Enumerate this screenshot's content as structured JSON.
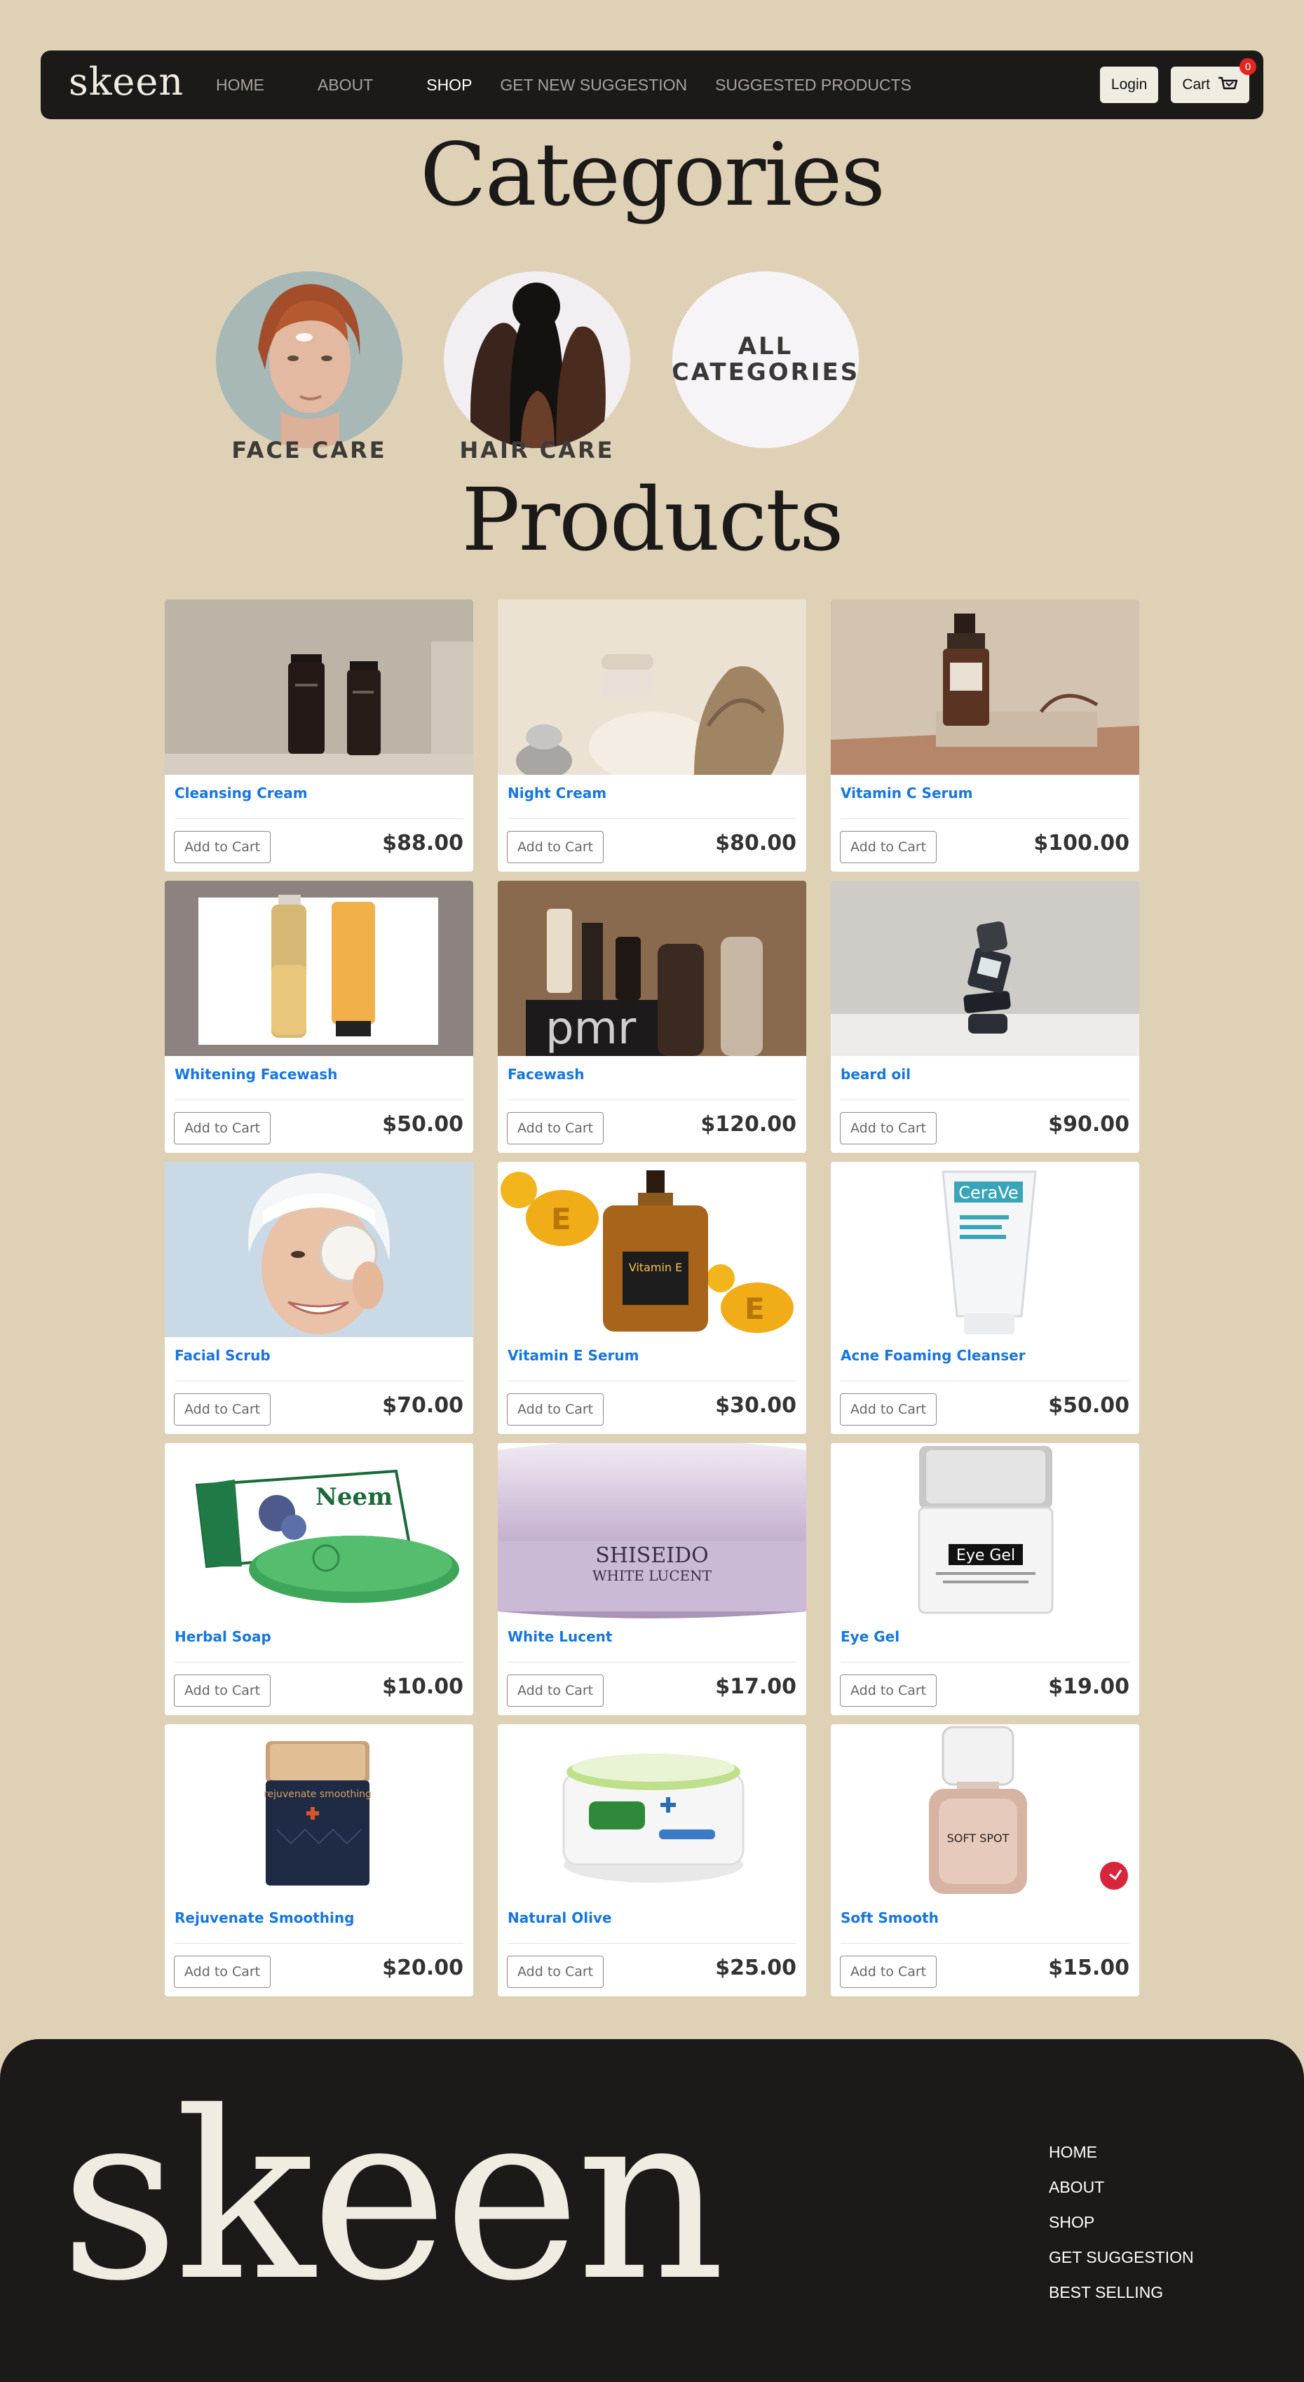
{
  "nav": {
    "brand": "skeen",
    "links": [
      "HOME",
      "ABOUT",
      "SHOP",
      "GET NEW SUGGESTION",
      "SUGGESTED PRODUCTS"
    ],
    "active": "SHOP",
    "login_label": "Login",
    "cart_label": "Cart",
    "cart_count": "0"
  },
  "headings": {
    "categories": "Categories",
    "products": "Products"
  },
  "categories": [
    {
      "label": "FACE CARE"
    },
    {
      "label": "HAIR CARE"
    },
    {
      "label_line1": "ALL",
      "label_line2": "CATEGORIES"
    }
  ],
  "products": [
    {
      "name": "Cleansing Cream",
      "price": "$88.00",
      "button": "Add to Cart",
      "icon": "amber-jars-image"
    },
    {
      "name": "Night Cream",
      "price": "$80.00",
      "button": "Add to Cart",
      "icon": "cream-jar-stones-image"
    },
    {
      "name": "Vitamin C Serum",
      "price": "$100.00",
      "button": "Add to Cart",
      "icon": "serum-bottle-image"
    },
    {
      "name": "Whitening Facewash",
      "price": "$50.00",
      "button": "Add to Cart",
      "icon": "facewash-bottles-image"
    },
    {
      "name": "Facewash",
      "price": "$120.00",
      "button": "Add to Cart",
      "icon": "cosmetics-set-image"
    },
    {
      "name": "beard oil",
      "price": "$90.00",
      "button": "Add to Cart",
      "icon": "stacked-jars-image"
    },
    {
      "name": "Facial Scrub",
      "price": "$70.00",
      "button": "Add to Cart",
      "icon": "woman-towel-image"
    },
    {
      "name": "Vitamin E Serum",
      "price": "$30.00",
      "button": "Add to Cart",
      "icon": "vitamin-e-bottle-image"
    },
    {
      "name": "Acne Foaming Cleanser",
      "price": "$50.00",
      "button": "Add to Cart",
      "icon": "cleanser-tube-image"
    },
    {
      "name": "Herbal Soap",
      "price": "$10.00",
      "button": "Add to Cart",
      "icon": "neem-soap-image"
    },
    {
      "name": "White Lucent",
      "price": "$17.00",
      "button": "Add to Cart",
      "icon": "shiseido-jar-image"
    },
    {
      "name": "Eye Gel",
      "price": "$19.00",
      "button": "Add to Cart",
      "icon": "eye-gel-jar-image"
    },
    {
      "name": "Rejuvenate Smoothing",
      "price": "$20.00",
      "button": "Add to Cart",
      "icon": "navy-jar-image"
    },
    {
      "name": "Natural Olive",
      "price": "$25.00",
      "button": "Add to Cart",
      "icon": "olive-cream-jar-image"
    },
    {
      "name": "Soft Smooth",
      "price": "$15.00",
      "button": "Add to Cart",
      "icon": "perfume-bottle-image"
    }
  ],
  "image_text": {
    "shiseido_brand": "SHISEIDO",
    "shiseido_product": "WHITE LUCENT",
    "eye_gel": "Eye Gel",
    "vitamin_e": "Vitamin E",
    "neem": "Neem",
    "soft_spot": "SOFT SPOT",
    "cerave": "CeraVe",
    "rejuvenate": "rejuvenate smoothing"
  },
  "footer": {
    "brand": "skeen",
    "links": [
      "HOME",
      "ABOUT",
      "SHOP",
      "GET SUGGESTION",
      "BEST SELLING"
    ]
  },
  "colors": {
    "background": "#dfd1b6",
    "dark": "#1c1a19",
    "cream": "#f1ece2",
    "link_blue": "#1676e0",
    "badge_red": "#e3261f"
  }
}
